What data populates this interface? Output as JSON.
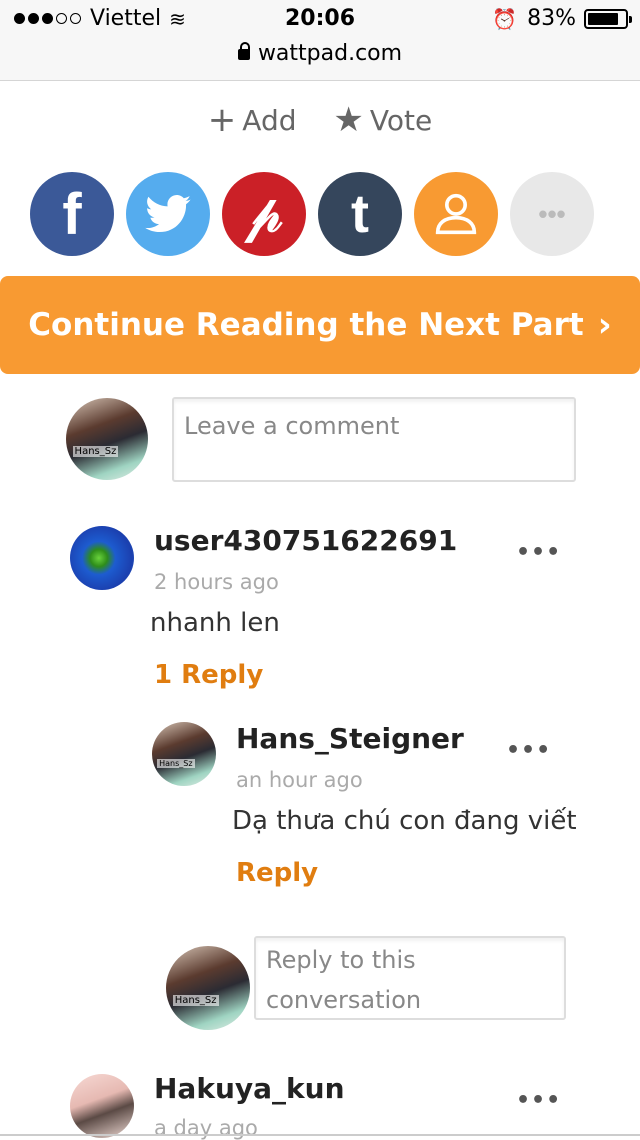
{
  "status": {
    "carrier": "Viettel",
    "time": "20:06",
    "battery": "83%"
  },
  "url": "wattpad.com",
  "actions": {
    "add": "Add",
    "vote": "Vote"
  },
  "social": [
    {
      "name": "facebook",
      "color": "#3b5998",
      "glyph": "f"
    },
    {
      "name": "twitter",
      "color": "#55acee",
      "glyph": "🐦"
    },
    {
      "name": "pinterest",
      "color": "#cb2027",
      "glyph": "P"
    },
    {
      "name": "tumblr",
      "color": "#35465c",
      "glyph": "t"
    },
    {
      "name": "user",
      "color": "#f89a32",
      "glyph": "👤"
    },
    {
      "name": "more",
      "color": "#e5e5e5",
      "glyph": "•••"
    }
  ],
  "next_button": "Continue Reading the Next Part",
  "comment_placeholder": "Leave a comment",
  "comments": [
    {
      "user": "user430751622691",
      "time": "2 hours ago",
      "text": "nhanh len",
      "reply_label": "1 Reply"
    }
  ],
  "replies": [
    {
      "user": "Hans_Steigner",
      "time": "an hour ago",
      "text": "Dạ thưa chú con đang viết",
      "reply_label": "Reply"
    }
  ],
  "reply_placeholder": "Reply to this conversation",
  "next_comment": {
    "user": "Hakuya_kun",
    "time": "a day ago"
  },
  "avatar_tag": "Hans_Sz",
  "more_glyph": "•••"
}
